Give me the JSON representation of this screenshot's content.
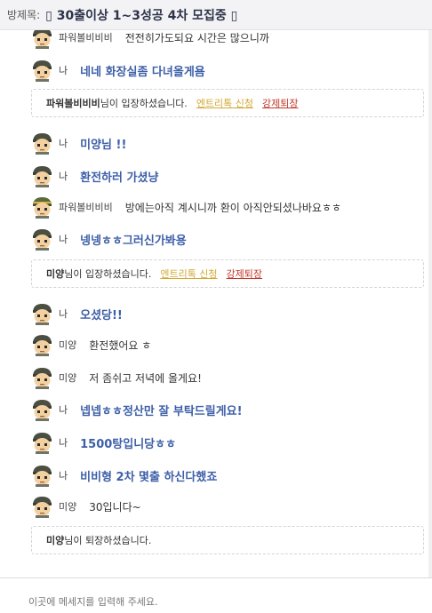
{
  "header": {
    "label": "방제목:",
    "title": "▯ 30출이상 1~3성공 4차 모집중 ▯"
  },
  "messages": [
    {
      "type": "chat",
      "sender": "파워볼비비비",
      "text": "전전히가도되요 시간은 많으니까",
      "self": false,
      "avatar_icon": "character-avatar-icon"
    },
    {
      "type": "chat",
      "sender": "나",
      "text": "네네 화장실좀 다녀올게욤",
      "self": true,
      "avatar_icon": "character-avatar-icon"
    },
    {
      "type": "system",
      "user": "파워볼비비비",
      "suffix": "님이 입장하셨습니다.",
      "link1": "엔트리톡 신청",
      "link2": "강제퇴장"
    },
    {
      "type": "chat",
      "sender": "나",
      "text": "미양님 !!",
      "self": true,
      "avatar_icon": "character-avatar-icon"
    },
    {
      "type": "chat",
      "sender": "나",
      "text": "환전하러 가셨냥",
      "self": true,
      "avatar_icon": "character-avatar-icon"
    },
    {
      "type": "chat",
      "sender": "파워볼비비비",
      "text": "방에는아직 계시니까 환이 아직안되셨나바요ㅎㅎ",
      "self": false,
      "avatar_icon": "character-avatar-icon"
    },
    {
      "type": "chat",
      "sender": "나",
      "text": "넹넹ㅎㅎ그러신가봐용",
      "self": true,
      "avatar_icon": "character-avatar-icon"
    },
    {
      "type": "system",
      "user": "미양",
      "suffix": "님이 입장하셨습니다.",
      "link1": "엔트리톡 신청",
      "link2": "강제퇴장"
    },
    {
      "type": "chat",
      "sender": "나",
      "text": "오셨당!!",
      "self": true,
      "avatar_icon": "character-avatar-icon"
    },
    {
      "type": "chat",
      "sender": "미양",
      "text": "환전했어요 ㅎ",
      "self": false,
      "avatar_icon": "character-avatar-icon"
    },
    {
      "type": "chat",
      "sender": "미양",
      "text": "저 좀쉬고 저녁에 올게요!",
      "self": false,
      "avatar_icon": "character-avatar-icon"
    },
    {
      "type": "chat",
      "sender": "나",
      "text": "넵넵ㅎㅎ정산만 잘 부탁드릴게요!",
      "self": true,
      "avatar_icon": "character-avatar-icon"
    },
    {
      "type": "chat",
      "sender": "나",
      "text": "1500탕입니당ㅎㅎ",
      "self": true,
      "avatar_icon": "character-avatar-icon"
    },
    {
      "type": "chat",
      "sender": "나",
      "text": "비비형 2차 몇출 하신다했죠",
      "self": true,
      "avatar_icon": "character-avatar-icon"
    },
    {
      "type": "chat",
      "sender": "미양",
      "text": "30입니다~",
      "self": false,
      "avatar_icon": "character-avatar-icon"
    },
    {
      "type": "system",
      "user": "미양",
      "suffix": "님이 퇴장하셨습니다.",
      "link1": "",
      "link2": ""
    }
  ],
  "input": {
    "placeholder": "이곳에 메세지를 입력해 주세요.",
    "value": ""
  },
  "colors": {
    "self_text": "#3d5fa8",
    "link_gold": "#d2a834",
    "link_red": "#c0392b",
    "header_bg": "#f3f3f5"
  }
}
